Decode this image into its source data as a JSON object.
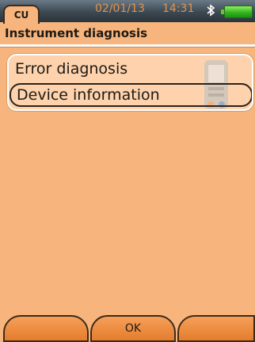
{
  "status_bar": {
    "tab": "CU",
    "date": "02/01/13",
    "time": "14:31",
    "bluetooth_icon": "bluetooth-icon",
    "battery_icon": "battery-icon"
  },
  "title": "Instrument diagnosis",
  "menu": {
    "items": [
      {
        "label": "Error diagnosis"
      },
      {
        "label": "Device information"
      }
    ],
    "decoration_icon": "instrument-device-icon"
  },
  "softkeys": {
    "left": "",
    "middle": "OK",
    "right": ""
  },
  "colors": {
    "background": "#f7b57d",
    "menu_background": "#fdd2ac",
    "accent": "#e57c2c"
  }
}
